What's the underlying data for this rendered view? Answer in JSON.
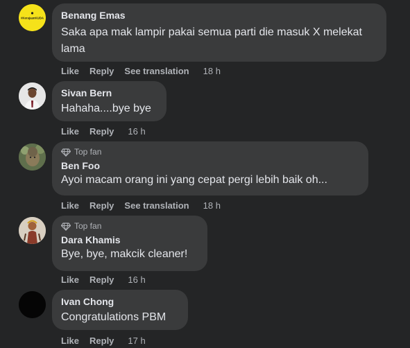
{
  "comments": [
    {
      "author": "Benang Emas",
      "text": "Saka apa mak lampir pakai semua parti die masuk X melekat lama",
      "avatar_label": "#KerajaanKUDA",
      "actions": {
        "like": "Like",
        "reply": "Reply",
        "translate": "See translation"
      },
      "time": "18 h"
    },
    {
      "author": "Sivan Bern",
      "text": "Hahaha....bye bye",
      "actions": {
        "like": "Like",
        "reply": "Reply"
      },
      "time": "16 h"
    },
    {
      "badge": "Top fan",
      "author": "Ben Foo",
      "text": "Ayoi macam orang ini yang cepat pergi lebih baik oh...",
      "actions": {
        "like": "Like",
        "reply": "Reply",
        "translate": "See translation"
      },
      "time": "18 h"
    },
    {
      "badge": "Top fan",
      "author": "Dara Khamis",
      "text": "Bye, bye, makcik cleaner!",
      "actions": {
        "like": "Like",
        "reply": "Reply"
      },
      "time": "16 h"
    },
    {
      "author": "Ivan Chong",
      "text": "Congratulations PBM",
      "actions": {
        "like": "Like",
        "reply": "Reply"
      },
      "time": "17 h"
    }
  ],
  "colors": {
    "background": "#242526",
    "bubble": "#3a3b3c",
    "primary_text": "#e4e6eb",
    "secondary_text": "#b0b3b8",
    "avatar_yellow": "#f5e21a"
  },
  "icons": {
    "badge": "diamond-icon"
  }
}
